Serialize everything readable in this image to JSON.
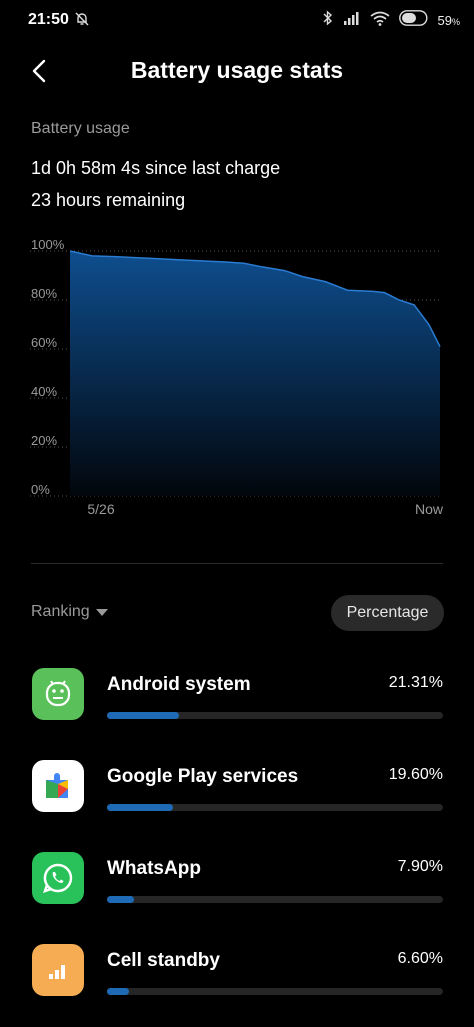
{
  "status_bar": {
    "time": "21:50",
    "battery": "59",
    "battery_suffix": "%"
  },
  "header": {
    "title": "Battery usage stats"
  },
  "summary": {
    "label": "Battery usage",
    "since_charge": "1d 0h 58m 4s since last charge",
    "remaining": "23 hours remaining"
  },
  "chart_data": {
    "type": "area",
    "y_ticks": [
      "100%",
      "80%",
      "60%",
      "40%",
      "20%",
      "0%"
    ],
    "x_ticks": [
      "5/26",
      "Now"
    ],
    "ylim": [
      0,
      100
    ],
    "x": [
      0,
      6,
      12,
      22,
      32,
      42,
      47,
      52,
      58,
      63,
      69,
      75,
      82,
      85,
      89,
      93,
      97,
      100
    ],
    "values": [
      100,
      98,
      97.7,
      97,
      96.2,
      95.5,
      95,
      93.5,
      92,
      89.5,
      87.5,
      84,
      83.5,
      83,
      80,
      78,
      70,
      61
    ],
    "colors": {
      "top": "#0e4e8f",
      "bottom": "#02060c",
      "line": "#2a7bd1",
      "grid": "#555555"
    }
  },
  "ranking": {
    "label": "Ranking",
    "sort_button": "Percentage"
  },
  "apps": [
    {
      "name": "Android system",
      "percent": "21.31%",
      "value": 21.31,
      "icon": "android-icon",
      "color": "#5ac05a"
    },
    {
      "name": "Google Play services",
      "percent": "19.60%",
      "value": 19.6,
      "icon": "google-play-services-icon",
      "color": "#ffffff"
    },
    {
      "name": "WhatsApp",
      "percent": "7.90%",
      "value": 7.9,
      "icon": "whatsapp-icon",
      "color": "#29c25a"
    },
    {
      "name": "Cell standby",
      "percent": "6.60%",
      "value": 6.6,
      "icon": "cell-signal-icon",
      "color": "#f6ac53"
    }
  ]
}
